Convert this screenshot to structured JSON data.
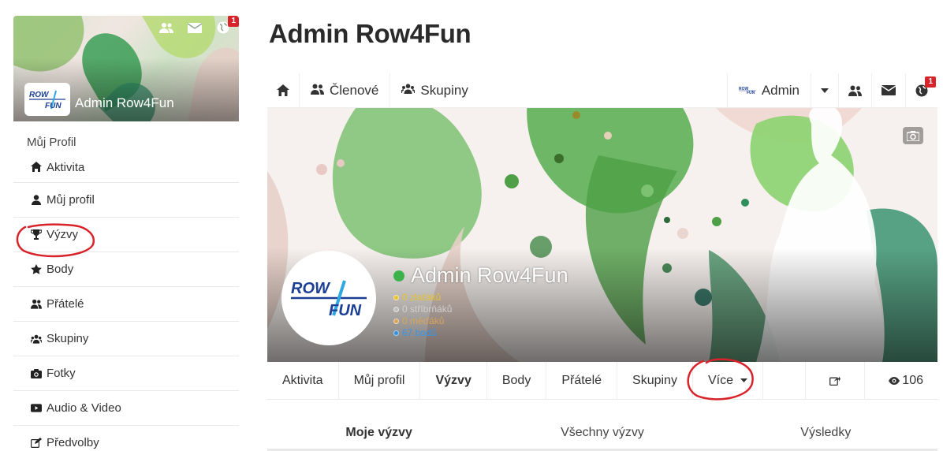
{
  "sidebar": {
    "cover_name": "Admin Row4Fun",
    "logo_text_top": "ROW",
    "logo_text_bottom": "FUN",
    "notifications_badge": "1",
    "section_title": "Můj Profil",
    "items": [
      {
        "label": "Aktivita",
        "icon": "home-icon"
      },
      {
        "label": "Můj profil",
        "icon": "user-icon"
      },
      {
        "label": "Výzvy",
        "icon": "trophy-icon"
      },
      {
        "label": "Body",
        "icon": "star-icon"
      },
      {
        "label": "Přátelé",
        "icon": "friends-icon"
      },
      {
        "label": "Skupiny",
        "icon": "groups-icon"
      },
      {
        "label": "Fotky",
        "icon": "camera-icon"
      },
      {
        "label": "Audio & Video",
        "icon": "play-icon"
      },
      {
        "label": "Předvolby",
        "icon": "edit-icon"
      }
    ]
  },
  "main": {
    "title": "Admin Row4Fun",
    "topnav": {
      "members": "Členové",
      "groups": "Skupiny",
      "admin": "Admin",
      "badge": "1"
    },
    "cover": {
      "name": "Admin Row4Fun",
      "stats": {
        "gold": "0 zlaťáků",
        "silver": "0 stříbrňáků",
        "bronze": "0 měďáků",
        "points": "67 bodů"
      },
      "colors": {
        "gold": "#e8c42c",
        "silver": "#bfbfbf",
        "bronze": "#d9a45a",
        "points": "#2f8fe0"
      }
    },
    "subnav": {
      "items": [
        "Aktivita",
        "Můj profil",
        "Výzvy",
        "Body",
        "Přátelé",
        "Skupiny"
      ],
      "more": "Více",
      "views": "106"
    },
    "tabs": [
      "Moje výzvy",
      "Všechny výzvy",
      "Výsledky"
    ]
  },
  "colors": {
    "annotation_red": "#d9232a",
    "online": "#3cb34a",
    "accent_green": "#5db34d"
  }
}
